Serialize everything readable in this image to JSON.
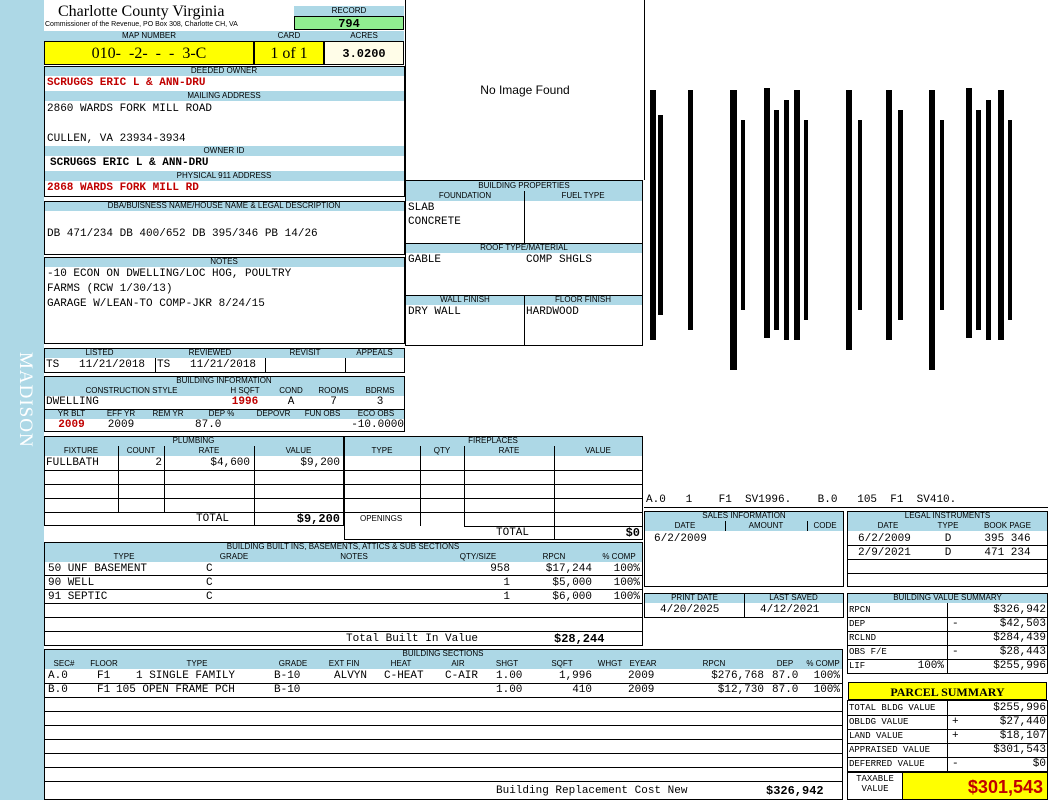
{
  "sidebar": {
    "district": "MADISON"
  },
  "header": {
    "county": "Charlotte County Virginia",
    "office": "Commissioner of the Revenue, PO Box 308, Charlotte CH, VA"
  },
  "record": {
    "label": "RECORD",
    "value": "794"
  },
  "map": {
    "label": "MAP NUMBER",
    "value": "010-  -2-  -  -  3-C",
    "card_label": "CARD",
    "card_value": "1 of 1",
    "acres_label": "ACRES",
    "acres_value": "3.0200"
  },
  "owner": {
    "label": "DEEDED OWNER",
    "name": "SCRUGGS ERIC L & ANN-DRU"
  },
  "mailing": {
    "label": "MAILING ADDRESS",
    "line1": "2860 WARDS FORK MILL ROAD",
    "line2": "CULLEN, VA 23934-3934"
  },
  "owner_id": {
    "label": "OWNER ID",
    "value": "SCRUGGS ERIC L & ANN-DRU"
  },
  "address911": {
    "label": "PHYSICAL 911 ADDRESS",
    "value": "2868 WARDS FORK MILL RD"
  },
  "legal": {
    "label": "DBA/BUISNESS NAME/HOUSE NAME & LEGAL DESCRIPTION",
    "value": "DB 471/234 DB 400/652 DB 395/346 PB 14/26"
  },
  "notes": {
    "label": "NOTES",
    "lines": [
      "-10 ECON ON DWELLING/LOC HOG, POULTRY",
      "FARMS (RCW 1/30/13)",
      "GARAGE W/LEAN-TO COMP-JKR 8/24/15"
    ]
  },
  "photo": {
    "text": "No Image Found"
  },
  "building_props": {
    "label": "BUILDING PROPERTIES",
    "foundation_label": "FOUNDATION",
    "foundation": [
      "SLAB",
      "CONCRETE"
    ],
    "fuel_label": "FUEL TYPE",
    "roof_label": "ROOF TYPE/MATERIAL",
    "roof_type": "GABLE",
    "roof_material": "COMP SHGLS",
    "wall_label": "WALL FINISH",
    "wall": "DRY WALL",
    "floor_label": "FLOOR FINISH",
    "floor": "HARDWOOD"
  },
  "sketch": {
    "caption": "A.0   1    F1  SV1996.    B.0   105  F1  SV410."
  },
  "review": {
    "listed_label": "LISTED",
    "listed": "TS   11/21/2018",
    "reviewed_label": "REVIEWED",
    "reviewed": "TS   11/21/2018",
    "revisit_label": "REVISIT",
    "appeals_label": "APPEALS"
  },
  "building_info": {
    "label": "BUILDING INFORMATION",
    "style_label": "CONSTRUCTION STYLE",
    "style": "DWELLING",
    "hsqft_label": "H SQFT",
    "hsqft": "1996",
    "cond_label": "COND",
    "cond": "A",
    "rooms_label": "ROOMS",
    "rooms": "7",
    "bdrms_label": "BDRMS",
    "bdrms": "3",
    "yrblt_label": "YR BLT",
    "yrblt": "2009",
    "effyr_label": "EFF YR",
    "effyr": "2009",
    "remyr_label": "REM YR",
    "dep_label": "DEP %",
    "dep": "87.0",
    "depovr_label": "DEPOVR",
    "funobs_label": "FUN OBS",
    "ecoobs_label": "ECO OBS",
    "ecoobs": "-10.0000"
  },
  "plumbing": {
    "label": "PLUMBING",
    "cols": [
      "FIXTURE",
      "COUNT",
      "RATE",
      "VALUE"
    ],
    "rows": [
      {
        "fixture": "FULLBATH",
        "count": "2",
        "rate": "$4,600",
        "value": "$9,200"
      }
    ],
    "total_label": "TOTAL",
    "total": "$9,200"
  },
  "fireplaces": {
    "label": "FIREPLACES",
    "cols": [
      "TYPE",
      "QTY",
      "RATE",
      "VALUE"
    ],
    "openings_label": "OPENINGS",
    "total_label": "TOTAL",
    "total": "$0"
  },
  "sales": {
    "label": "SALES INFORMATION",
    "cols": [
      "DATE",
      "AMOUNT",
      "CODE"
    ],
    "rows": [
      {
        "date": "6/2/2009",
        "amount": "",
        "code": ""
      }
    ]
  },
  "legal_instr": {
    "label": "LEGAL INSTRUMENTS",
    "cols": [
      "DATE",
      "TYPE",
      "BOOK PAGE"
    ],
    "rows": [
      {
        "date": "6/2/2009",
        "type": "D",
        "book": "395 346"
      },
      {
        "date": "2/9/2021",
        "type": "D",
        "book": "471 234"
      }
    ]
  },
  "builtins": {
    "label": "BUILDING BUILT INS, BASEMENTS, ATTICS & SUB SECTIONS",
    "cols": [
      "TYPE",
      "GRADE",
      "NOTES",
      "QTY/SIZE",
      "RPCN",
      "% COMP"
    ],
    "rows": [
      {
        "type": "50 UNF BASEMENT",
        "grade": "C",
        "notes": "",
        "qty": "958",
        "rpcn": "$17,244",
        "comp": "100%"
      },
      {
        "type": "90 WELL",
        "grade": "C",
        "notes": "",
        "qty": "1",
        "rpcn": "$5,000",
        "comp": "100%"
      },
      {
        "type": "91 SEPTIC",
        "grade": "C",
        "notes": "",
        "qty": "1",
        "rpcn": "$6,000",
        "comp": "100%"
      }
    ],
    "total_label": "Total Built In Value",
    "total": "$28,244"
  },
  "print": {
    "print_label": "PRINT DATE",
    "print_date": "4/20/2025",
    "saved_label": "LAST SAVED",
    "saved_date": "4/12/2021"
  },
  "value_summary": {
    "label": "BUILDING VALUE SUMMARY",
    "rows": [
      {
        "label": "RPCN",
        "sign": "",
        "value": "$326,942"
      },
      {
        "label": "DEP",
        "sign": "-",
        "value": "$42,503"
      },
      {
        "label": "RCLND",
        "sign": "",
        "value": "$284,439"
      },
      {
        "label": "OBS F/E",
        "sign": "-",
        "value": "$28,443"
      },
      {
        "label": "LIF",
        "sign": "",
        "pct": "100%",
        "value": "$255,996"
      }
    ]
  },
  "sections": {
    "label": "BUILDING SECTIONS",
    "cols": [
      "SEC#",
      "FLOOR",
      "TYPE",
      "GRADE",
      "EXT FIN",
      "HEAT",
      "AIR",
      "SHGT",
      "SQFT",
      "WHGT",
      "EYEAR",
      "RPCN",
      "DEP",
      "% COMP"
    ],
    "rows": [
      {
        "sec": "A.0",
        "floor": "F1",
        "type": "1 SINGLE FAMILY",
        "grade": "B-10",
        "extfin": "ALVYN",
        "heat": "C-HEAT",
        "air": "C-AIR",
        "shgt": "1.00",
        "sqft": "1,996",
        "whgt": "",
        "eyear": "2009",
        "rpcn": "$276,768",
        "dep": "87.0",
        "comp": "100%"
      },
      {
        "sec": "B.0",
        "floor": "F1",
        "type": "105 OPEN FRAME PCH",
        "grade": "B-10",
        "extfin": "",
        "heat": "",
        "air": "",
        "shgt": "1.00",
        "sqft": "410",
        "whgt": "",
        "eyear": "2009",
        "rpcn": "$12,730",
        "dep": "87.0",
        "comp": "100%"
      }
    ],
    "total_label": "Building Replacement Cost New",
    "total": "$326,942"
  },
  "parcel": {
    "label": "PARCEL SUMMARY",
    "rows": [
      {
        "label": "TOTAL BLDG VALUE",
        "sign": "",
        "value": "$255,996"
      },
      {
        "label": "OBLDG VALUE",
        "sign": "+",
        "value": "$27,440"
      },
      {
        "label": "LAND VALUE",
        "sign": "+",
        "value": "$18,107"
      },
      {
        "label": "APPRAISED VALUE",
        "sign": "",
        "value": "$301,543"
      },
      {
        "label": "DEFERRED VALUE",
        "sign": "-",
        "value": "$0"
      }
    ],
    "taxable_label": "TAXABLE VALUE",
    "taxable": "$301,543"
  },
  "colors": {
    "header_blue": "#add8e6",
    "highlight_yellow": "#ffff00",
    "record_green": "#90ee90",
    "accent_red": "#c00000"
  }
}
